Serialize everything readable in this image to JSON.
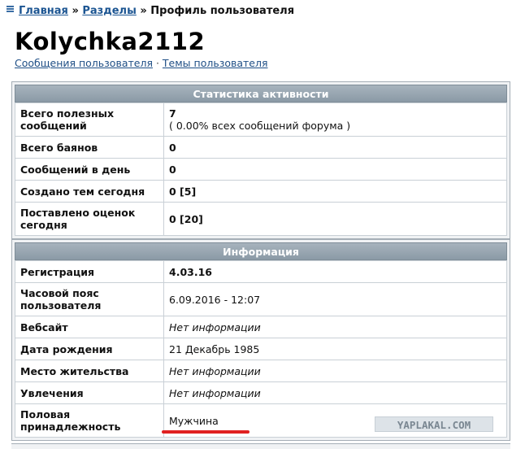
{
  "breadcrumb": {
    "home": "Главная",
    "sep1": "»",
    "sections": "Разделы",
    "sep2": "»",
    "current": "Профиль пользователя"
  },
  "user": {
    "name": "Kolychka2112",
    "link_messages": "Сообщения пользователя",
    "link_sep": "·",
    "link_topics": "Темы пользователя"
  },
  "activity": {
    "title": "Статистика активности",
    "rows": [
      {
        "label": "Всего полезных сообщений",
        "value": "7",
        "sub": "( 0.00% всех сообщений форума )"
      },
      {
        "label": "Всего баянов",
        "value": "0"
      },
      {
        "label": "Сообщений в день",
        "value": "0"
      },
      {
        "label": "Создано тем сегодня",
        "value": "0 [5]"
      },
      {
        "label": "Поставлено оценок сегодня",
        "value": "0 [20]"
      }
    ]
  },
  "info": {
    "title": "Информация",
    "rows": [
      {
        "label": "Регистрация",
        "value": "4.03.16"
      },
      {
        "label": "Часовой пояс пользователя",
        "value": "6.09.2016 - 12:07"
      },
      {
        "label": "Вебсайт",
        "value": "Нет информации"
      },
      {
        "label": "Дата рождения",
        "value": "21 Декабрь 1985"
      },
      {
        "label": "Место жительства",
        "value": "Нет информации"
      },
      {
        "label": "Увлечения",
        "value": "Нет информации"
      },
      {
        "label": "Половая принадлежность",
        "value": "Мужчина"
      }
    ]
  },
  "watermark": "YAPLAKAL.COM",
  "colors": {
    "link": "#1c5592",
    "header_bg": "#98a6b1",
    "highlight_mark": "#e02020"
  }
}
